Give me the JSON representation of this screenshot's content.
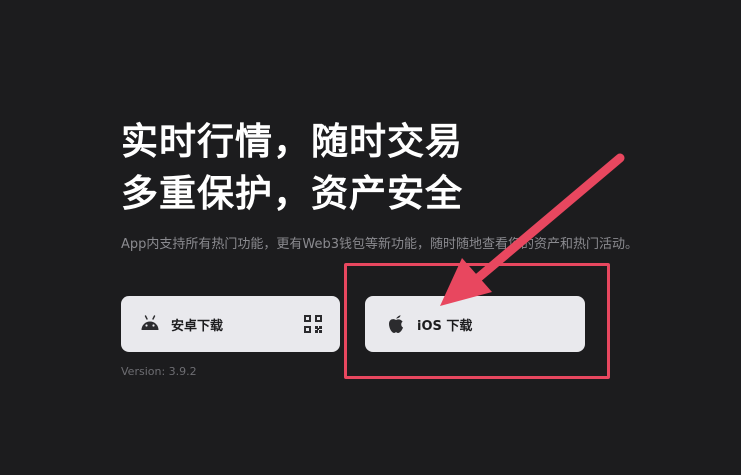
{
  "hero": {
    "headline_line1": "实时行情，随时交易",
    "headline_line2": "多重保护，资产安全",
    "subtitle": "App内支持所有热门功能，更有Web3钱包等新功能，随时随地查看您的资产和热门活动。"
  },
  "downloads": {
    "android_label": "安卓下载",
    "android_icon": "android-icon",
    "qr_icon": "qr-code-icon",
    "ios_label": "iOS 下载",
    "ios_icon": "apple-icon"
  },
  "version_text": "Version: 3.9.2",
  "annotation": {
    "color": "#e8475f"
  },
  "colors": {
    "background": "#1c1c1e",
    "button_bg": "#e9e9ed",
    "headline": "#ffffff",
    "subtitle": "#8a8a8f"
  }
}
